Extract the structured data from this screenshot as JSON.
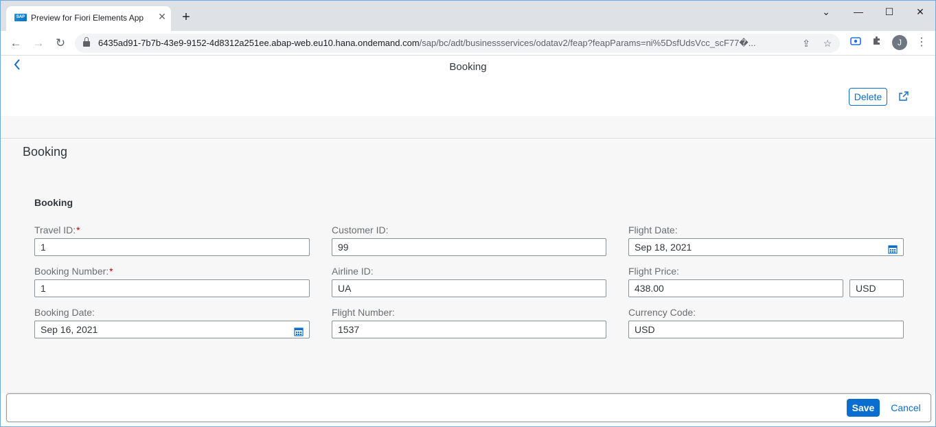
{
  "browser": {
    "tab_title": "Preview for Fiori Elements App",
    "favicon_text": "SAP",
    "url_host": "6435ad91-7b7b-43e9-9152-4d8312a251ee.abap-web.eu10.hana.ondemand.com",
    "url_path": "/sap/bc/adt/businessservices/odatav2/feap?feapParams=ni%5DsfUdsVcc_scF77�...",
    "avatar_letter": "J"
  },
  "shellbar": {
    "title": "Booking"
  },
  "header": {
    "delete_label": "Delete"
  },
  "object": {
    "title": "Booking"
  },
  "section": {
    "title": "Booking"
  },
  "fields": {
    "travel_id": {
      "label": "Travel ID:",
      "required_mark": "*",
      "value": "1"
    },
    "booking_number": {
      "label": "Booking Number:",
      "required_mark": "*",
      "value": "1"
    },
    "booking_date": {
      "label": "Booking Date:",
      "value": "Sep 16, 2021"
    },
    "customer_id": {
      "label": "Customer ID:",
      "value": "99"
    },
    "airline_id": {
      "label": "Airline ID:",
      "value": "UA"
    },
    "flight_number": {
      "label": "Flight Number:",
      "value": "1537"
    },
    "flight_date": {
      "label": "Flight Date:",
      "value": "Sep 18, 2021"
    },
    "flight_price": {
      "label": "Flight Price:",
      "value": "438.00",
      "currency": "USD"
    },
    "currency_code": {
      "label": "Currency Code:",
      "value": "USD"
    }
  },
  "footer": {
    "save_label": "Save",
    "cancel_label": "Cancel"
  },
  "colors": {
    "accent": "#0a6ed1",
    "required": "#bb0000",
    "page_bg": "#f7f7f7"
  }
}
